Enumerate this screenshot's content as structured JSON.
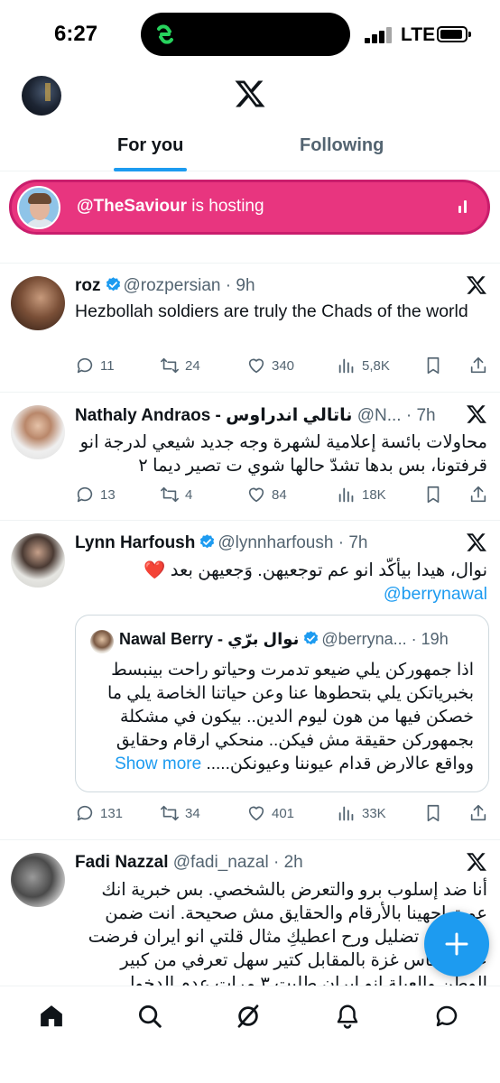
{
  "status_bar": {
    "time": "6:27",
    "network": "LTE"
  },
  "tabs": [
    {
      "label": "For you",
      "active": true
    },
    {
      "label": "Following",
      "active": false
    }
  ],
  "space": {
    "host": "@TheSaviour",
    "suffix": " is hosting",
    "color": "#e8357f"
  },
  "accent": "#1d9bf0",
  "tweets": [
    {
      "name": "roz",
      "handle": "@rozpersian",
      "time": "9h",
      "text": "Hezbollah soldiers are truly the Chads of the world",
      "replies": "11",
      "retweets": "24",
      "likes": "340",
      "views": "5,8K"
    },
    {
      "name": "Nathaly Andraos - ناتالي اندراوس",
      "handle": "@N...",
      "time": "7h",
      "text": "محاولات بائسة إعلامية لشهرة وجه جديد شيعي لدرجة انو قرفتونا، بس بدها تشدّ حالها شوي ت تصير ديما ٢",
      "replies": "13",
      "retweets": "4",
      "likes": "84",
      "views": "18K"
    },
    {
      "name": "Lynn Harfoush",
      "handle": "@lynnharfoush",
      "time": "7h",
      "text": "نوال، هيدا بيأكّد انو عم توجعيهن. وَجعيهن بعد ❤️",
      "mention": "@berrynawal",
      "quote": {
        "name": "Nawal Berry - نوال برّي",
        "handle": "@berryna...",
        "time": "19h",
        "text": "اذا جمهوركن يلي ضيعو تدمرت وحياتو راحت بينبسط بخبرياتكن يلي بتحطوها عنا وعن حياتنا الخاصة يلي ما خصكن فيها من هون ليوم الدين.. بيكون في مشكلة بجمهوركن حقيقة مش فيكن.. منحكي ارقام وحقايق وواقع عالارض قدام عيوننا وعيونكن.....",
        "show_more": "Show more"
      },
      "replies": "131",
      "retweets": "34",
      "likes": "401",
      "views": "33K"
    },
    {
      "name": "Fadi Nazzal",
      "handle": "@fadi_nazal",
      "time": "2h",
      "text": "أنا ضد إسلوب برو والتعرض بالشخصي. بس خبرية انك عم تواجهينا بالأرقام والحقايق مش صحيحة. انت ضمن حملة عم تضليل ورح اعطيكِ مثال قلتي انو ايران فرضت على حماس غزة بالمقابل كتير سهل تعرفي من كبير الوطن والعيلة انو ايران طلبت ٣ مرات عدم الدخول والسيد رفض"
    }
  ],
  "nav": [
    "home",
    "search",
    "grok",
    "notifications",
    "messages"
  ]
}
